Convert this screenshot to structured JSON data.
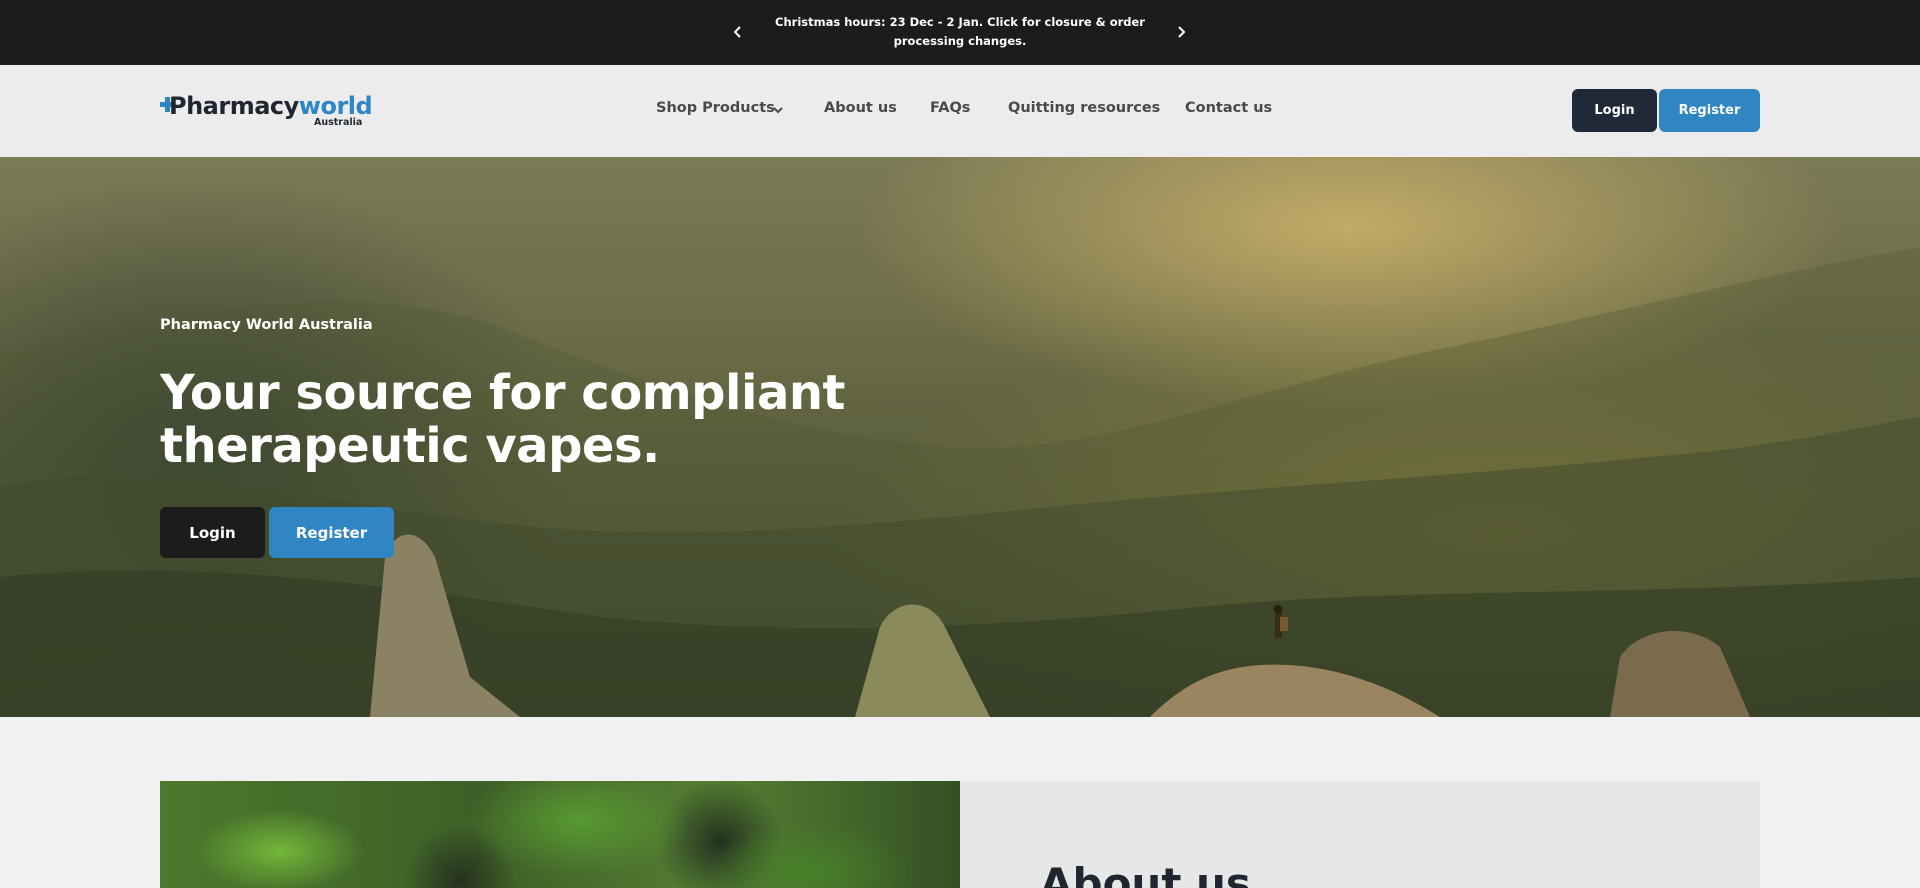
{
  "announcement": {
    "message": "Christmas hours: 23 Dec - 2 Jan. Click for closure & order processing changes.",
    "prev_icon": "chevron-left-icon",
    "next_icon": "chevron-right-icon"
  },
  "header": {
    "logo": {
      "part1": "Pharmacy",
      "part2": "world",
      "subtitle": "Australia",
      "icon": "plus-cross-icon"
    },
    "nav": [
      {
        "label": "Shop Products",
        "icon": "chevron-down-icon"
      },
      {
        "label": "About us"
      },
      {
        "label": "FAQs"
      },
      {
        "label": "Quitting resources"
      },
      {
        "label": "Contact us"
      }
    ],
    "login_label": "Login",
    "register_label": "Register"
  },
  "hero": {
    "eyebrow": "Pharmacy World Australia",
    "headline": "Your source for compliant therapeutic vapes.",
    "login_label": "Login",
    "register_label": "Register"
  },
  "about": {
    "title": "About us"
  },
  "colors": {
    "brand_blue": "#2f86c3",
    "dark": "#1c1c1c",
    "navy": "#1f2937",
    "page_bg": "#f1f1f1"
  }
}
